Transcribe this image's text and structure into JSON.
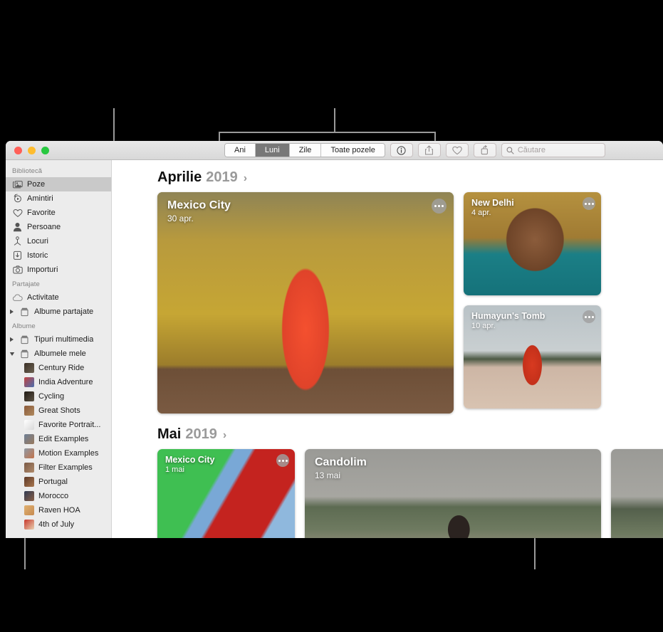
{
  "window": {
    "traffic_lights": [
      "close",
      "minimize",
      "zoom"
    ]
  },
  "toolbar": {
    "segments": [
      {
        "label": "Ani",
        "active": false
      },
      {
        "label": "Luni",
        "active": true
      },
      {
        "label": "Zile",
        "active": false
      },
      {
        "label": "Toate pozele",
        "active": false
      }
    ],
    "buttons": [
      {
        "name": "info-button",
        "icon": "info-icon"
      },
      {
        "name": "share-button",
        "icon": "share-icon"
      },
      {
        "name": "favorite-button",
        "icon": "heart-icon"
      },
      {
        "name": "rotate-button",
        "icon": "rotate-icon"
      }
    ],
    "search": {
      "placeholder": "Căutare",
      "value": ""
    }
  },
  "sidebar": {
    "sections": [
      {
        "title": "Bibliotecă",
        "items": [
          {
            "label": "Poze",
            "icon": "photos-icon",
            "selected": true
          },
          {
            "label": "Amintiri",
            "icon": "memories-icon",
            "selected": false
          },
          {
            "label": "Favorite",
            "icon": "heart-icon",
            "selected": false
          },
          {
            "label": "Persoane",
            "icon": "person-icon",
            "selected": false
          },
          {
            "label": "Locuri",
            "icon": "places-pin-icon",
            "selected": false
          },
          {
            "label": "Istoric",
            "icon": "recents-download-icon",
            "selected": false
          },
          {
            "label": "Importuri",
            "icon": "camera-icon",
            "selected": false
          }
        ]
      },
      {
        "title": "Partajate",
        "items": [
          {
            "label": "Activitate",
            "icon": "cloud-icon",
            "selected": false
          },
          {
            "label": "Albume partajate",
            "icon": "album-icon",
            "selected": false,
            "disclosure": "collapsed"
          }
        ]
      },
      {
        "title": "Albume",
        "items": [
          {
            "label": "Tipuri multimedia",
            "icon": "album-icon",
            "selected": false,
            "disclosure": "collapsed"
          },
          {
            "label": "Albumele mele",
            "icon": "album-icon",
            "selected": false,
            "disclosure": "expanded"
          }
        ]
      }
    ],
    "my_albums": [
      {
        "label": "Century Ride",
        "color1": "#3a3026",
        "color2": "#6d6252"
      },
      {
        "label": "India Adventure",
        "color1": "#c2423f",
        "color2": "#4a6fb0"
      },
      {
        "label": "Cycling",
        "color1": "#1f1a14",
        "color2": "#5d5344"
      },
      {
        "label": "Great Shots",
        "color1": "#8a5a3a",
        "color2": "#b08a5e"
      },
      {
        "label": "Favorite Portrait...",
        "color1": "#ffffff",
        "color2": "#d8d8d8"
      },
      {
        "label": "Edit Examples",
        "color1": "#6d7f96",
        "color2": "#9a7a5e"
      },
      {
        "label": "Motion Examples",
        "color1": "#8e9aa6",
        "color2": "#c4734a"
      },
      {
        "label": "Filter Examples",
        "color1": "#7a5a46",
        "color2": "#b08a6a"
      },
      {
        "label": "Portugal",
        "color1": "#5e3a28",
        "color2": "#a8764e"
      },
      {
        "label": "Morocco",
        "color1": "#2f3a52",
        "color2": "#8a5e44"
      },
      {
        "label": "Raven HOA",
        "color1": "#e0b070",
        "color2": "#c68a50"
      },
      {
        "label": "4th of July",
        "color1": "#c8392e",
        "color2": "#e8d0b0"
      }
    ]
  },
  "content": {
    "months": [
      {
        "name": "Aprilie",
        "year": "2019",
        "chevron": "›",
        "cards": [
          {
            "title": "Mexico City",
            "date": "30 apr.",
            "size": "big",
            "art": "ph-mexico",
            "more": "more-options-button"
          },
          {
            "title": "New Delhi",
            "date": "4 apr.",
            "size": "small",
            "art": "ph-delhi",
            "more": "more-options-button"
          },
          {
            "title": "Humayun's Tomb",
            "date": "10 apr.",
            "size": "small",
            "art": "ph-humayun",
            "more": "more-options-button"
          }
        ]
      },
      {
        "name": "Mai",
        "year": "2019",
        "chevron": "›",
        "cards": [
          {
            "title": "Mexico City",
            "date": "1 mai",
            "size": "small",
            "art": "ph-mexico2",
            "more": "more-options-button"
          },
          {
            "title": "Candolim",
            "date": "13 mai",
            "size": "big",
            "art": "ph-candolim",
            "more": "more-options-button"
          },
          {
            "title": "",
            "date": "",
            "size": "small",
            "art": "ph-candolim2",
            "more": "more-options-button"
          }
        ]
      }
    ]
  },
  "colors": {
    "selected_row": "#c9c9c9",
    "active_segment": "#787878",
    "sidebar_bg": "#ececec",
    "callout_line": "#9a9a9a"
  }
}
